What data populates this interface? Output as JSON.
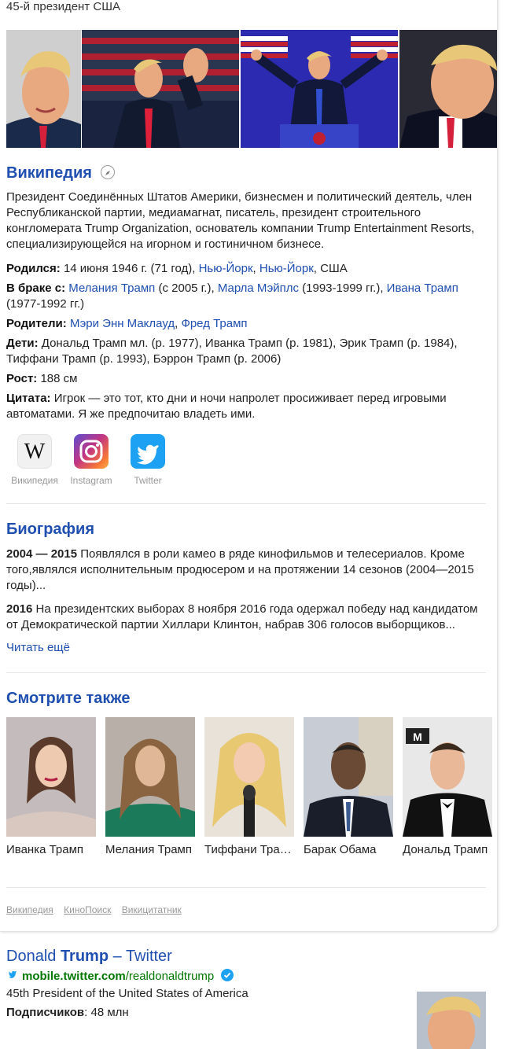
{
  "entity": {
    "subtitle": "45-й президент США"
  },
  "wiki": {
    "heading": "Википедия",
    "description": "Президент Соединённых Штатов Америки, бизнесмен и политический деятель, член Республиканской партии, медиамагнат, писатель, президент строительного конгломерата Trump Organization, основатель компании Trump Entertainment Resorts, специализирующейся на игорном и гостиничном бизнесе."
  },
  "facts": {
    "born_label": "Родился:",
    "born_text": "14 июня 1946 г. (71 год),",
    "born_link1": "Нью-Йорк",
    "born_sep": ",",
    "born_link2": "Нью-Йорк",
    "born_country": ", США",
    "married_label": "В браке с:",
    "spouse1": "Мелания Трамп",
    "spouse1_years": "(с 2005 г.),",
    "spouse2": "Марла Мэйплс",
    "spouse2_years": "(1993-1999 гг.),",
    "spouse3": "Ивана Трамп",
    "spouse3_years": "(1977-1992 гг.)",
    "parents_label": "Родители:",
    "parent1": "Мэри Энн Маклауд",
    "parent_sep": ",",
    "parent2": "Фред Трамп",
    "children_label": "Дети:",
    "children_text": "Дональд Трамп мл. (р. 1977), Иванка Трамп (р. 1981), Эрик Трамп (р. 1984), Тиффани Трамп (р. 1993), Бэррон Трамп (р. 2006)",
    "height_label": "Рост:",
    "height_text": "188 см",
    "quote_label": "Цитата:",
    "quote_text": "Игрок — это тот, кто дни и ночи напролет просиживает перед игровыми автоматами. Я же предпочитаю владеть ими."
  },
  "socials": [
    {
      "label": "Википедия",
      "icon": "wikipedia-icon"
    },
    {
      "label": "Instagram",
      "icon": "instagram-icon"
    },
    {
      "label": "Twitter",
      "icon": "twitter-icon"
    }
  ],
  "biography": {
    "heading": "Биография",
    "entries": [
      {
        "year": "2004 — 2015",
        "text": "Появлялся в роли камео в ряде кинофильмов и телесериалов. Кроме того,являлся исполнительным продюсером и на протяжении 14 сезонов (2004—2015 годы)..."
      },
      {
        "year": "2016",
        "text": "На президентских выборах 8 ноября 2016 года одержал победу над кандидатом от Демократической партии Хиллари Клинтон, набрав 306 голосов выборщиков..."
      }
    ],
    "read_more": "Читать ещё"
  },
  "see_also": {
    "heading": "Смотрите также",
    "items": [
      {
        "name": "Иванка Трамп"
      },
      {
        "name": "Мелания Трамп"
      },
      {
        "name": "Тиффани Тра…"
      },
      {
        "name": "Барак Обама"
      },
      {
        "name": "Дональд Трамп"
      }
    ]
  },
  "sources": [
    "Википедия",
    "КиноПоиск",
    "Викицитатник"
  ],
  "result": {
    "title_pre": "Donald ",
    "title_bold": "Trump",
    "title_post": " – Twitter",
    "url_bold": "mobile.twitter.com",
    "url_rest": "/realdonaldtrump",
    "description": "45th President of the United States of America",
    "followers_label": "Подписчиков",
    "followers_value": ": 48 млн"
  },
  "colors": {
    "link": "#1f4fb0",
    "url_green": "#007700",
    "twitter_blue": "#1da1f2"
  }
}
